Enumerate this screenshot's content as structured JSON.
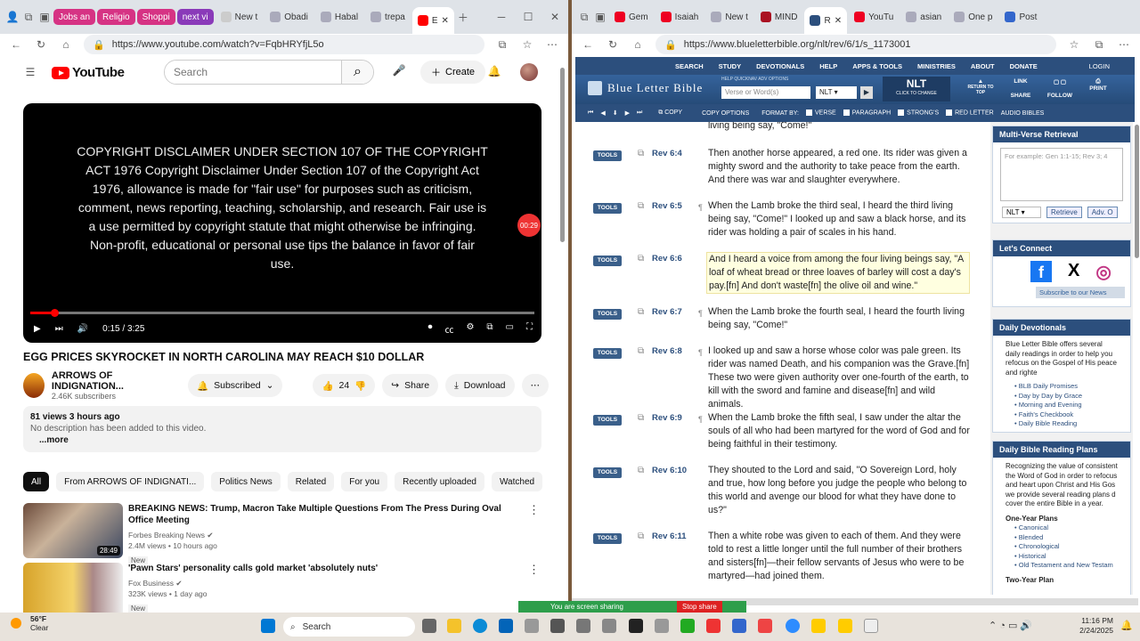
{
  "yt_window": {
    "tabs": [
      {
        "label": "Jobs an",
        "color": "#d63384"
      },
      {
        "label": "Religio",
        "color": "#d63384"
      },
      {
        "label": "Shoppi",
        "color": "#d63384"
      },
      {
        "label": "next vi",
        "color": "#8a3ab9"
      },
      {
        "label": "New t"
      },
      {
        "label": "Obadi"
      },
      {
        "label": "Habal"
      },
      {
        "label": "trepa"
      },
      {
        "label": "E",
        "active": true
      }
    ],
    "url": "https://www.youtube.com/watch?v=FqbHRYfjL5o"
  },
  "youtube": {
    "logo": "YouTube",
    "search_placeholder": "Search",
    "create_label": "Create",
    "disclaimer": "COPYRIGHT DISCLAIMER UNDER SECTION 107 OF THE COPYRIGHT ACT 1976 Copyright Disclaimer Under Section 107 of the Copyright Act 1976, allowance is made for \"fair use\" for purposes such as criticism, comment, news reporting, teaching, scholarship, and research. Fair use is a use permitted by copyright statute that might otherwise be infringing. Non-profit, educational or personal use tips the balance in favor of fair use.",
    "badge": "00:29",
    "time": "0:15 / 3:25",
    "progress_fraction": 0.073,
    "title": "EGG PRICES SKYROCKET IN NORTH CAROLINA MAY REACH $10 DOLLAR",
    "channel": "ARROWS OF INDIGNATION...",
    "subscribers": "2.46K subscribers",
    "subscribed_label": "Subscribed",
    "likes": "24",
    "share_label": "Share",
    "download_label": "Download",
    "views_time": "81 views  3 hours ago",
    "description": "No description has been added to this video.",
    "more": "...more",
    "chips": [
      "All",
      "From ARROWS OF INDIGNATI...",
      "Politics News",
      "Related",
      "For you",
      "Recently uploaded",
      "Watched"
    ],
    "recommendations": [
      {
        "title": "BREAKING NEWS: Trump, Macron Take Multiple Questions From The Press During Oval Office Meeting",
        "channel": "Forbes Breaking News",
        "meta": "2.4M views  •  10 hours ago",
        "badge": "New",
        "duration": "28:49"
      },
      {
        "title": "'Pawn Stars' personality calls gold market 'absolutely nuts'",
        "channel": "Fox Business",
        "meta": "323K views  •  1 day ago",
        "badge": "New",
        "duration": ""
      }
    ]
  },
  "blb_window": {
    "tabs": [
      {
        "label": "Gem"
      },
      {
        "label": "Isaiah"
      },
      {
        "label": "New t"
      },
      {
        "label": "MIND"
      },
      {
        "label": "R",
        "active": true
      },
      {
        "label": "YouTu"
      },
      {
        "label": "asian"
      },
      {
        "label": "One p"
      },
      {
        "label": "Post"
      }
    ],
    "url": "https://www.blueletterbible.org/nlt/rev/6/1/s_1173001"
  },
  "blb": {
    "nav": [
      "SEARCH",
      "STUDY",
      "DEVOTIONALS",
      "HELP",
      "APPS & TOOLS",
      "MINISTRIES",
      "ABOUT",
      "DONATE"
    ],
    "login": "LOGIN",
    "logo": "Blue Letter Bible",
    "quick_links": "HELP   QUICKNAV   ADV OPTIONS",
    "search_placeholder": "Verse or Word(s)",
    "version": "NLT",
    "version_caption": "CLICK TO CHANGE",
    "return_top": "RETURN TO TOP",
    "link": "LINK",
    "share": "SHARE",
    "follow": "FOLLOW",
    "print": "PRINT",
    "toolbar": [
      "COPY",
      "COPY OPTIONS",
      "FORMAT BY:",
      "VERSE",
      "PARAGRAPH",
      "STRONG'S",
      "RED LETTER",
      "AUDIO BIBLES"
    ],
    "prev_text": "living being say, \"Come!\"",
    "verses": [
      {
        "ref": "Rev 6:4",
        "para": "",
        "text": "Then another horse appeared, a red one. Its rider was given a mighty sword and the authority to take peace from the earth. And there was war and slaughter everywhere."
      },
      {
        "ref": "Rev 6:5",
        "para": "¶",
        "text": "When the Lamb broke the third seal, I heard the third living being say, \"Come!\" I looked up and saw a black horse, and its rider was holding a pair of scales in his hand."
      },
      {
        "ref": "Rev 6:6",
        "para": "",
        "text": "And I heard a voice from among the four living beings say, \"A loaf of wheat bread or three loaves of barley will cost a day's pay.[fn] And don't waste[fn] the olive oil and wine.\"",
        "highlight": true
      },
      {
        "ref": "Rev 6:7",
        "para": "¶",
        "text": "When the Lamb broke the fourth seal, I heard the fourth living being say, \"Come!\""
      },
      {
        "ref": "Rev 6:8",
        "para": "¶",
        "text": "I looked up and saw a horse whose color was pale green. Its rider was named Death, and his companion was the Grave.[fn] These two were given authority over one-fourth of the earth, to kill with the sword and famine and disease[fn] and wild animals."
      },
      {
        "ref": "Rev 6:9",
        "para": "¶",
        "text": "When the Lamb broke the fifth seal, I saw under the altar the souls of all who had been martyred for the word of God and for being faithful in their testimony."
      },
      {
        "ref": "Rev 6:10",
        "para": "",
        "text": "They shouted to the Lord and said, \"O Sovereign Lord, holy and true, how long before you judge the people who belong to this world and avenge our blood for what they have done to us?\""
      },
      {
        "ref": "Rev 6:11",
        "para": "",
        "text": "Then a white robe was given to each of them. And they were told to rest a little longer until the full number of their brothers and sisters[fn]—their fellow servants of Jesus who were to be martyred—had joined them."
      }
    ],
    "tools_label": "TOOLS",
    "sidebar": {
      "mvr_title": "Multi-Verse Retrieval",
      "mvr_placeholder": "For example: Gen 1:1-15; Rev 3; 4",
      "mvr_version": "NLT",
      "retrieve": "Retrieve",
      "adv": "Adv. O",
      "connect_title": "Let's Connect",
      "subscribe": "Subscribe to our News",
      "devo_title": "Daily Devotionals",
      "devo_text": "Blue Letter Bible offers several daily readings in order to help you refocus on the Gospel of His peace and righte",
      "devo_links": [
        "BLB Daily Promises",
        "Day by Day by Grace",
        "Morning and Evening",
        "Faith's Checkbook",
        "Daily Bible Reading"
      ],
      "plans_title": "Daily Bible Reading Plans",
      "plans_text": "Recognizing the value of consistent the Word of God in order to refocus and heart upon Christ and His Gos we provide several reading plans d cover the entire Bible in a year.",
      "one_year": "One-Year Plans",
      "one_year_links": [
        "Canonical",
        "Blended",
        "Chronological",
        "Historical",
        "Old Testament and New Testam"
      ],
      "two_year": "Two-Year Plan"
    }
  },
  "taskbar": {
    "weather_temp": "56°F",
    "weather_desc": "Clear",
    "search": "Search",
    "time": "11:16 PM",
    "date": "2/24/2025",
    "sharing": "You are screen sharing",
    "stop": "Stop share"
  }
}
